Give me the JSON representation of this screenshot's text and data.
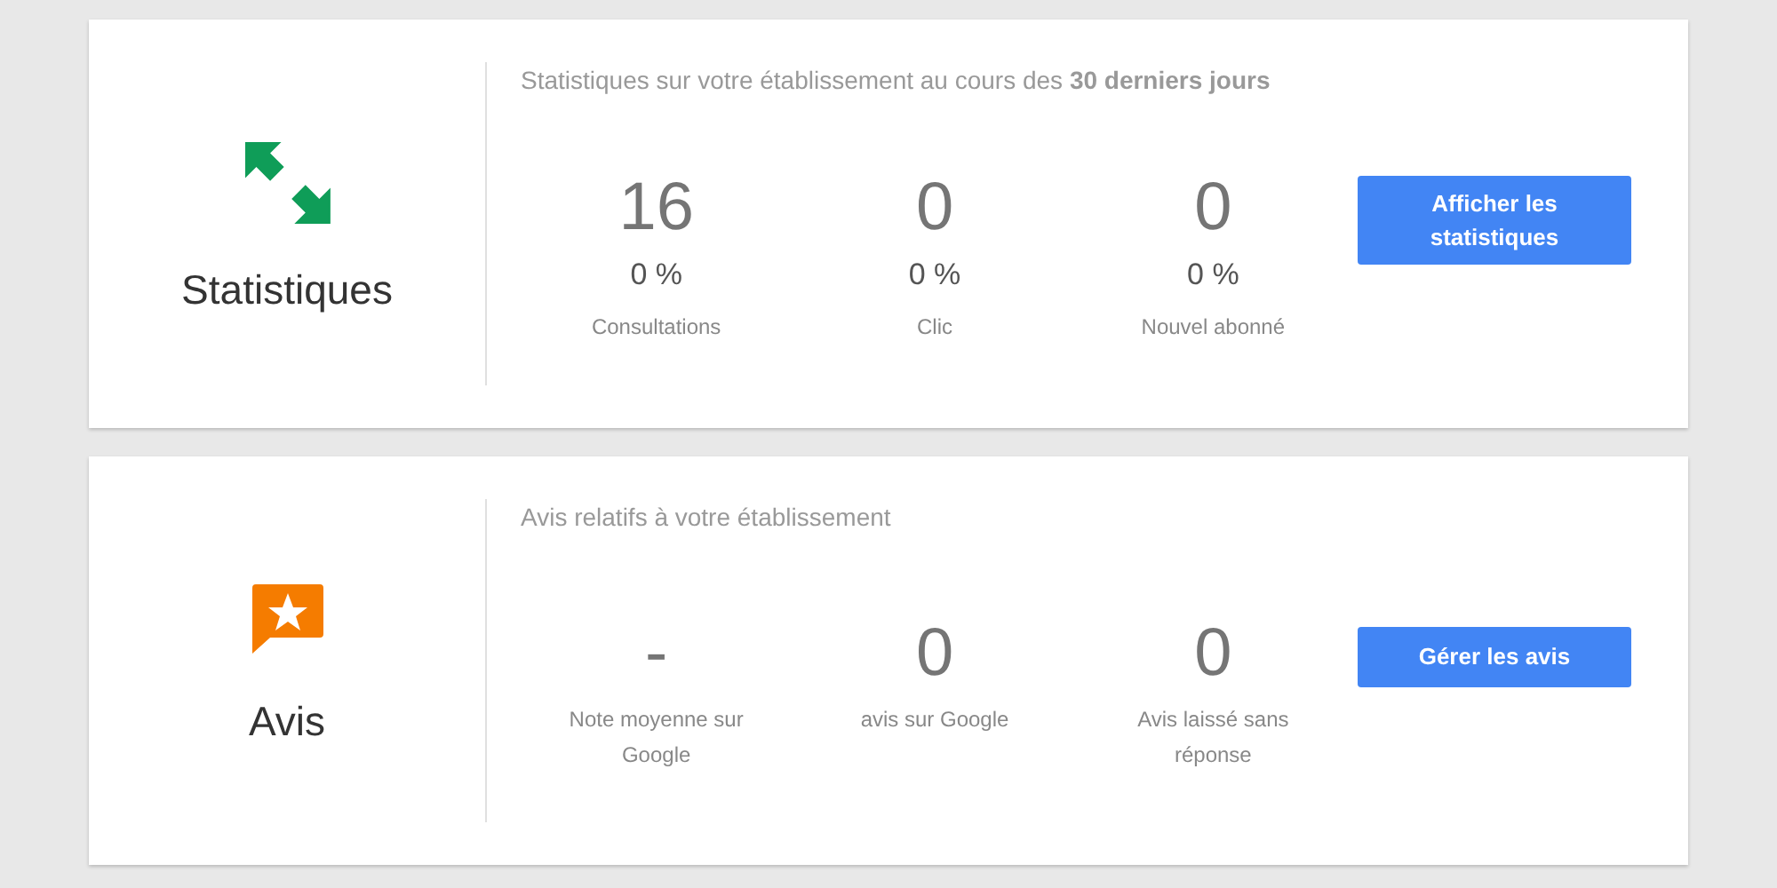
{
  "cards": [
    {
      "kind": "stats",
      "title": "Statistiques",
      "heading": "Statistiques sur votre établissement au cours des **30 derniers jours**",
      "metrics": [
        {
          "value": "16",
          "change": "0 %",
          "label": "Consultations"
        },
        {
          "value": "0",
          "change": "0 %",
          "label": "Clic"
        },
        {
          "value": "0",
          "change": "0 %",
          "label": "Nouvel abonné"
        }
      ],
      "button": "Afficher les statistiques"
    },
    {
      "kind": "reviews",
      "title": "Avis",
      "heading": "Avis relatifs à votre établissement",
      "metrics": [
        {
          "value": "-",
          "label": "Note moyenne sur Google"
        },
        {
          "value": "0",
          "label": "avis sur Google"
        },
        {
          "value": "0",
          "label": "Avis laissé sans réponse"
        }
      ],
      "button": "Gérer les avis"
    }
  ]
}
